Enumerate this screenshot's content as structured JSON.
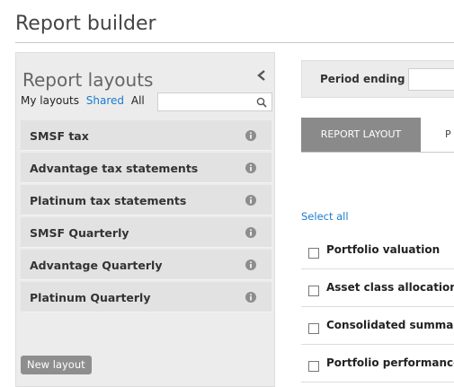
{
  "page": {
    "title": "Report builder"
  },
  "layouts_panel": {
    "title": "Report layouts",
    "filters": {
      "mine": "My layouts",
      "shared": "Shared",
      "all": "All"
    },
    "search": {
      "value": "",
      "placeholder": ""
    },
    "items": [
      {
        "label": "SMSF tax"
      },
      {
        "label": "Advantage tax statements"
      },
      {
        "label": "Platinum tax statements"
      },
      {
        "label": "SMSF Quarterly"
      },
      {
        "label": "Advantage Quarterly"
      },
      {
        "label": "Platinum Quarterly"
      }
    ],
    "new_layout_label": "New layout",
    "icons": {
      "collapse": "chevron-left-icon",
      "search": "search-icon",
      "info": "info-icon"
    }
  },
  "main": {
    "period": {
      "label": "Period ending",
      "value": ""
    },
    "tabs": [
      {
        "label": "REPORT LAYOUT",
        "active": true
      },
      {
        "label": "P",
        "active": false
      }
    ],
    "select_all_label": "Select all",
    "sections": [
      {
        "label": "Portfolio valuation",
        "checked": false
      },
      {
        "label": "Asset class allocation",
        "checked": false
      },
      {
        "label": "Consolidated summar",
        "checked": false
      },
      {
        "label": "Portfolio performance",
        "checked": false
      }
    ]
  },
  "colors": {
    "panel_bg": "#ececec",
    "item_bg": "#e2e2e2",
    "link": "#1a7bd0",
    "active_tab": "#8a8a8a",
    "button": "#8e8e8e"
  }
}
